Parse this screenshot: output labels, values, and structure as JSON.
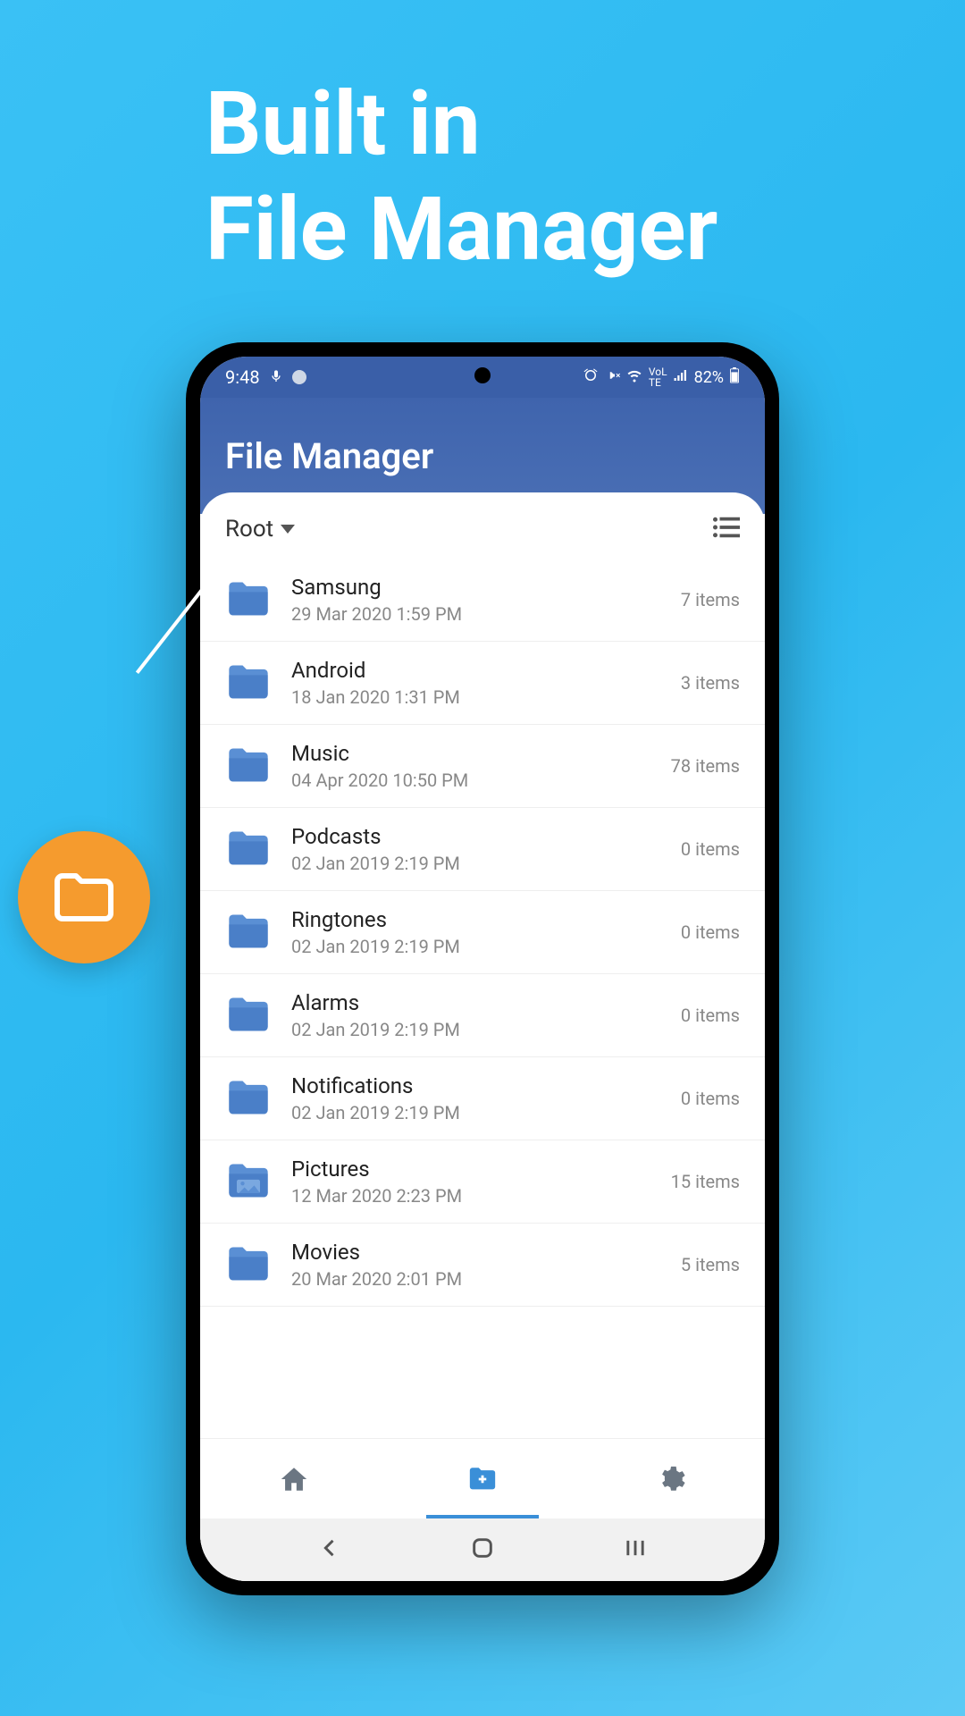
{
  "hero": {
    "line1": "Built in",
    "line2": "File Manager"
  },
  "status_bar": {
    "time": "9:48",
    "battery": "82%"
  },
  "app": {
    "title": "File Manager"
  },
  "breadcrumb": {
    "current": "Root"
  },
  "folders": [
    {
      "name": "Samsung",
      "date": "29 Mar 2020 1:59 PM",
      "count": "7 items",
      "type": "folder"
    },
    {
      "name": "Android",
      "date": "18 Jan 2020 1:31 PM",
      "count": "3 items",
      "type": "folder"
    },
    {
      "name": "Music",
      "date": "04 Apr 2020 10:50 PM",
      "count": "78 items",
      "type": "folder"
    },
    {
      "name": "Podcasts",
      "date": "02 Jan 2019 2:19 PM",
      "count": "0 items",
      "type": "folder"
    },
    {
      "name": "Ringtones",
      "date": "02 Jan 2019 2:19 PM",
      "count": "0 items",
      "type": "folder"
    },
    {
      "name": "Alarms",
      "date": "02 Jan 2019 2:19 PM",
      "count": "0 items",
      "type": "folder"
    },
    {
      "name": "Notifications",
      "date": "02 Jan 2019 2:19 PM",
      "count": "0 items",
      "type": "folder"
    },
    {
      "name": "Pictures",
      "date": "12 Mar 2020 2:23 PM",
      "count": "15 items",
      "type": "pictures"
    },
    {
      "name": "Movies",
      "date": "20 Mar 2020 2:01 PM",
      "count": "5 items",
      "type": "folder"
    }
  ]
}
